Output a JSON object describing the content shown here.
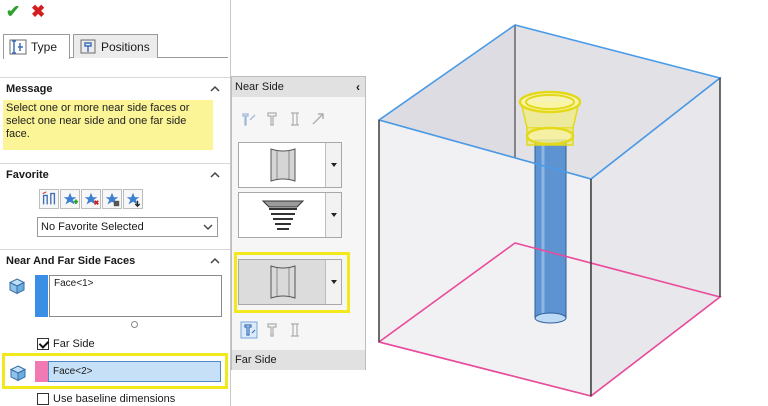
{
  "property_manager": {
    "tabs": [
      {
        "label": "Type",
        "icon": "hole-type-icon"
      },
      {
        "label": "Positions",
        "icon": "hole-position-icon"
      }
    ],
    "message_group": {
      "title": "Message",
      "text": "Select one or more near side faces or select one near side and one far side face."
    },
    "favorite_group": {
      "title": "Favorite",
      "selected": "No Favorite Selected"
    },
    "faces_group": {
      "title": "Near And Far Side Faces",
      "near_faces": [
        "Face<1>"
      ],
      "far_side_label": "Far Side",
      "far_side_checked": true,
      "far_face": "Face<2>",
      "baseline_label": "Use baseline dimensions",
      "baseline_checked": false,
      "near_color": "#3a8ee6",
      "far_color": "#f27ab4"
    }
  },
  "flyout": {
    "near_title": "Near Side",
    "far_title": "Far Side"
  },
  "colors": {
    "highlight": "#f3e81c",
    "top_edges": "#4a9be8",
    "bottom_edges": "#ea4b9c",
    "hole": "#5e93d1"
  }
}
